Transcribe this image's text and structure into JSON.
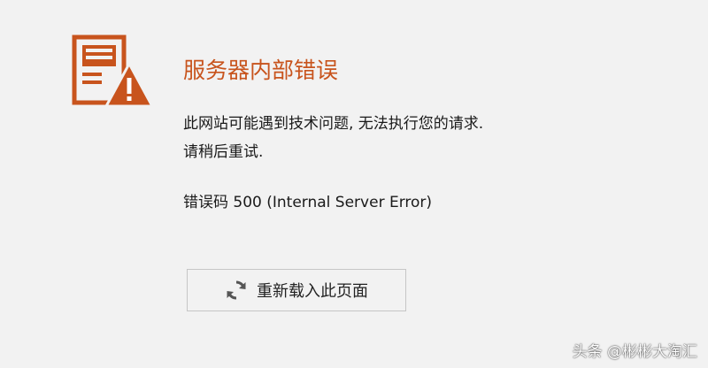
{
  "error": {
    "title": "服务器内部错误",
    "desc_line1": "此网站可能遇到技术问题, 无法执行您的请求.",
    "desc_line2": "请稍后重试.",
    "code_line": "错误码 500 (Internal Server Error)"
  },
  "actions": {
    "reload_label": "重新载入此页面",
    "reload_icon": "refresh-icon"
  },
  "watermark": {
    "text": "头条 @彬彬大淘汇"
  },
  "colors": {
    "accent": "#c8541d",
    "background": "#f2f2f2",
    "text": "#1a1a1a"
  },
  "icons": {
    "main": "server-warning-icon"
  }
}
